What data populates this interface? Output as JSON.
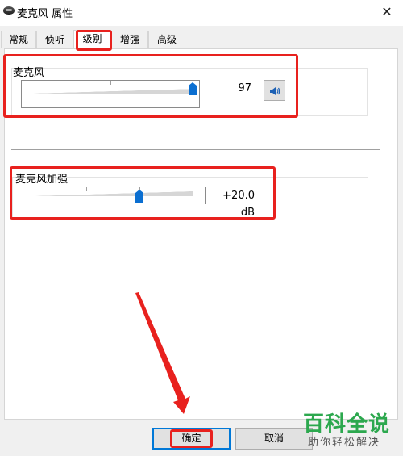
{
  "window": {
    "title": "麦克风 属性",
    "close_glyph": "✕"
  },
  "tabs": [
    {
      "label": "常规"
    },
    {
      "label": "侦听"
    },
    {
      "label": "级别",
      "active": true
    },
    {
      "label": "增强"
    },
    {
      "label": "高级"
    }
  ],
  "microphone": {
    "label": "麦克风",
    "value": "97",
    "level": 97,
    "max": 100,
    "mute_icon": "speaker-icon"
  },
  "boost": {
    "label": "麦克风加强",
    "value": "+20.0 dB",
    "level_db": 20.0,
    "max_db": 30.0,
    "step_db": 10.0
  },
  "buttons": {
    "ok": "确定",
    "cancel": "取消"
  },
  "watermark": {
    "main": "百科全说",
    "sub": "助你轻松解决"
  },
  "colors": {
    "accent": "#0b6fd1",
    "annotation": "#e8211e",
    "watermark": "#2ca84e"
  }
}
